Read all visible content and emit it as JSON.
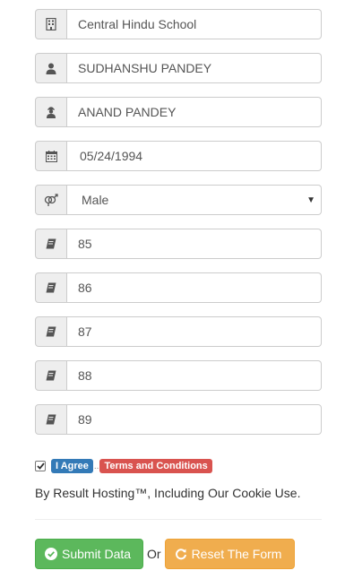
{
  "form": {
    "school": "Central Hindu School",
    "student_name": "SUDHANSHU PANDEY",
    "father_name": "ANAND PANDEY",
    "dob": "05/24/1994",
    "gender_selected": "Male",
    "marks": [
      "85",
      "86",
      "87",
      "88",
      "89"
    ]
  },
  "agreement": {
    "agree_label": "I Agree",
    "dots": "..",
    "terms_label": "Terms and Conditions",
    "checked": true,
    "text": "By Result Hosting™, Including Our Cookie Use."
  },
  "buttons": {
    "submit_label": "Submit Data",
    "or_label": "Or",
    "reset_label": "Reset The Form"
  },
  "colors": {
    "success": "#5cb85c",
    "warning": "#f0ad4e",
    "primary": "#337ab7",
    "danger": "#d9534f"
  },
  "icons": [
    "building-icon",
    "user-icon",
    "parent-icon",
    "calendar-icon",
    "gender-icon",
    "book-icon"
  ]
}
